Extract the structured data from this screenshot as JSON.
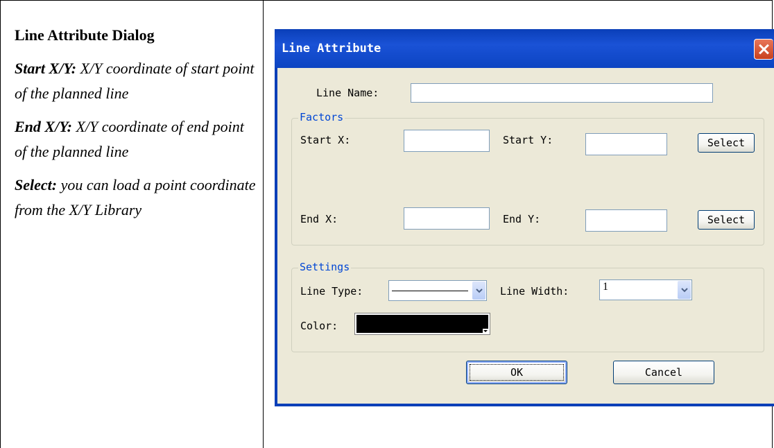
{
  "doc": {
    "title": "Line Attribute Dialog",
    "items": [
      {
        "term": "Start X/Y:",
        "text": " X/Y coordinate of start point of the planned line"
      },
      {
        "term": "End X/Y:",
        "text": " X/Y coordinate of end point of the planned line"
      },
      {
        "term": "Select:",
        "text": " you can load a point coordinate from the X/Y Library"
      }
    ]
  },
  "dialog": {
    "title": "Line Attribute",
    "line_name_label": "Line Name:",
    "line_name_value": "",
    "factors": {
      "title": "Factors",
      "start_x_label": "Start X:",
      "start_x_value": "",
      "start_y_label": "Start Y:",
      "start_y_value": "",
      "end_x_label": "End X:",
      "end_x_value": "",
      "end_y_label": "End Y:",
      "end_y_value": "",
      "select_start_label": "Select",
      "select_end_label": "Select"
    },
    "settings": {
      "title": "Settings",
      "line_type_label": "Line Type:",
      "line_width_label": "Line Width:",
      "line_width_value": "1",
      "color_label": "Color:",
      "color_value": "#000000"
    },
    "ok_label": "OK",
    "cancel_label": "Cancel"
  },
  "colors": {
    "titlebar": "#0a3fb8",
    "client": "#ece9d8",
    "group_title": "#0046d5"
  }
}
